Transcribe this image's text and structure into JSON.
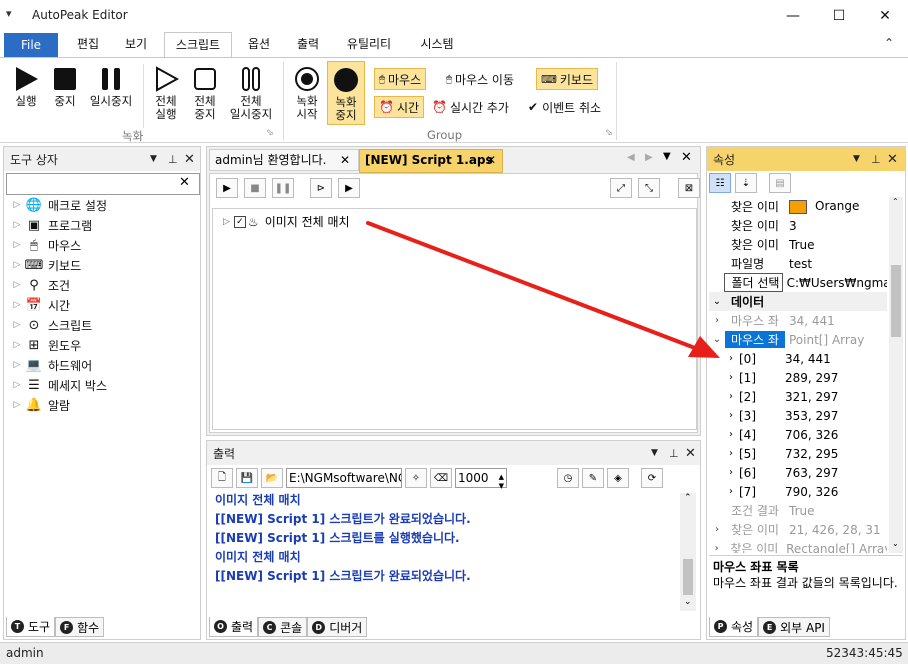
{
  "window": {
    "title": "AutoPeak Editor",
    "menu_glyph": "▾",
    "min": "—",
    "max": "☐",
    "close": "✕"
  },
  "ribbon_tabs": [
    "File",
    "편집",
    "보기",
    "스크립트",
    "옵션",
    "출력",
    "유틸리티",
    "시스템"
  ],
  "ribbon_collapse": "⌃",
  "ribbon": {
    "run": "실행",
    "stop": "중지",
    "pause": "일시중지",
    "run_all": "전체\n실행",
    "stop_all": "전체\n중지",
    "pause_all": "전체\n일시중지",
    "group_record": "녹화",
    "rec_start": "녹화\n시작",
    "rec_stop": "녹화\n중지",
    "mouse": "마우스",
    "mouse_move": "마우스 이동",
    "keyboard": "키보드",
    "time": "시간",
    "realtime_add": "실시간 추가",
    "event_cancel": "이벤트 취소",
    "group_group": "Group"
  },
  "toolbox": {
    "title": "도구 상자",
    "search_placeholder": "",
    "clear": "✕",
    "items": [
      {
        "label": "매크로 설정",
        "icon": "globe-icon",
        "glyph": "🌐"
      },
      {
        "label": "프로그램",
        "icon": "program-icon",
        "glyph": "▣"
      },
      {
        "label": "마우스",
        "icon": "mouse-icon",
        "glyph": "🖱"
      },
      {
        "label": "키보드",
        "icon": "keyboard-icon",
        "glyph": "⌨"
      },
      {
        "label": "조건",
        "icon": "condition-icon",
        "glyph": "⚲"
      },
      {
        "label": "시간",
        "icon": "calendar-icon",
        "glyph": "📅"
      },
      {
        "label": "스크립트",
        "icon": "script-icon",
        "glyph": "⊙"
      },
      {
        "label": "윈도우",
        "icon": "windows-icon",
        "glyph": "⊞"
      },
      {
        "label": "하드웨어",
        "icon": "laptop-icon",
        "glyph": "💻"
      },
      {
        "label": "메세지 박스",
        "icon": "message-icon",
        "glyph": "☰"
      },
      {
        "label": "알람",
        "icon": "bell-icon",
        "glyph": "🔔"
      }
    ],
    "tab_tools": "도구",
    "tab_functions": "함수",
    "tab_tools_letter": "T",
    "tab_functions_letter": "F"
  },
  "editor": {
    "tab_welcome": "admin님 환영합니다.",
    "tab_script": "[NEW] Script 1.aps",
    "tab_close": "✕",
    "node_label": "이미지 전체 매치"
  },
  "output": {
    "title": "출력",
    "path": "E:\\NGMsoftware\\NG",
    "count": "1000",
    "lines": [
      "이미지 전체 매치",
      "[[NEW] Script 1] 스크립트가 완료되었습니다.",
      "[[NEW] Script 1] 스크립트를 실행했습니다.",
      "이미지 전체 매치",
      "[[NEW] Script 1] 스크립트가 완료되었습니다."
    ],
    "tab_output": "출력",
    "tab_console": "콘솔",
    "tab_debugger": "디버거",
    "tab_output_letter": "O",
    "tab_console_letter": "C",
    "tab_debugger_letter": "D"
  },
  "properties": {
    "title": "속성",
    "rows": [
      {
        "name": "찾은 이미",
        "value": "Orange",
        "swatch": "#f5a000"
      },
      {
        "name": "찾은 이미",
        "value": "3"
      },
      {
        "name": "찾은 이미",
        "value": "True"
      },
      {
        "name": "파일명",
        "value": "test"
      },
      {
        "name": "폴더 선택",
        "value": "C:₩Users₩ngma"
      }
    ],
    "category_data": "데이터",
    "data_rows": [
      {
        "name": "마우스 좌",
        "value": "34, 441"
      },
      {
        "name": "마우스 좌",
        "value": "Point[] Array"
      }
    ],
    "points": [
      {
        "index": "[0]",
        "value": "34, 441"
      },
      {
        "index": "[1]",
        "value": "289, 297"
      },
      {
        "index": "[2]",
        "value": "321, 297"
      },
      {
        "index": "[3]",
        "value": "353, 297"
      },
      {
        "index": "[4]",
        "value": "706, 326"
      },
      {
        "index": "[5]",
        "value": "732, 295"
      },
      {
        "index": "[6]",
        "value": "763, 297"
      },
      {
        "index": "[7]",
        "value": "790, 326"
      }
    ],
    "tail_rows": [
      {
        "name": "조건 결과",
        "value": "True"
      },
      {
        "name": "찾은 이미",
        "value": "21, 426, 28, 31"
      },
      {
        "name": "찾은 이미",
        "value": "Rectangle[] Array"
      }
    ],
    "desc_title": "마우스 좌표 목록",
    "desc_text": "마우스 좌표 결과 값들의 목록입니다.",
    "tab_properties": "속성",
    "tab_external_api": "외부 API",
    "tab_properties_letter": "P",
    "tab_external_api_letter": "E"
  },
  "status": {
    "user": "admin",
    "clock": "52343:45:45"
  },
  "colors": {
    "accent": "#2b6cc4",
    "highlight": "#fce49c",
    "arrow": "#e8201a",
    "output_text": "#1a3db5"
  }
}
